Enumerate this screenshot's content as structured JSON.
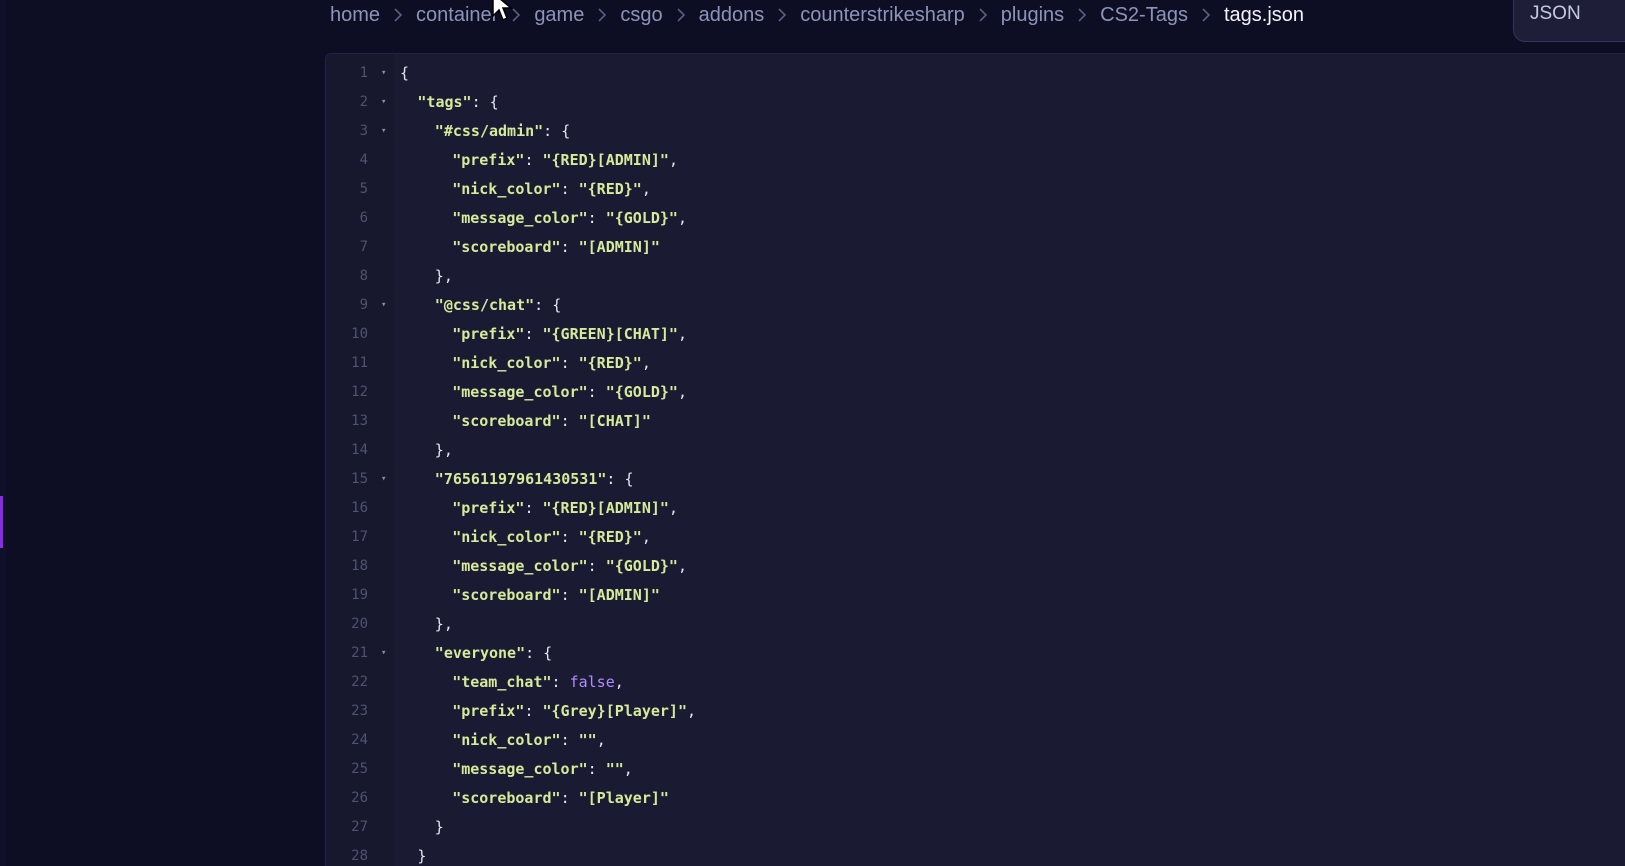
{
  "breadcrumb": {
    "items": [
      "home",
      "container",
      "game",
      "csgo",
      "addons",
      "counterstrikesharp",
      "plugins",
      "CS2-Tags",
      "tags.json"
    ]
  },
  "language_badge": "JSON",
  "editor": {
    "lines": [
      {
        "n": "1",
        "fold": true,
        "indent": 0,
        "parts": [
          [
            "p",
            "{"
          ]
        ]
      },
      {
        "n": "2",
        "fold": true,
        "indent": 1,
        "parts": [
          [
            "k",
            "\"tags\""
          ],
          [
            "p",
            ": {"
          ]
        ]
      },
      {
        "n": "3",
        "fold": true,
        "indent": 2,
        "parts": [
          [
            "k",
            "\"#css/admin\""
          ],
          [
            "p",
            ": {"
          ]
        ]
      },
      {
        "n": "4",
        "fold": false,
        "indent": 3,
        "parts": [
          [
            "k",
            "\"prefix\""
          ],
          [
            "p",
            ": "
          ],
          [
            "s",
            "\"{RED}[ADMIN]\""
          ],
          [
            "p",
            ","
          ]
        ]
      },
      {
        "n": "5",
        "fold": false,
        "indent": 3,
        "parts": [
          [
            "k",
            "\"nick_color\""
          ],
          [
            "p",
            ": "
          ],
          [
            "s",
            "\"{RED}\""
          ],
          [
            "p",
            ","
          ]
        ]
      },
      {
        "n": "6",
        "fold": false,
        "indent": 3,
        "parts": [
          [
            "k",
            "\"message_color\""
          ],
          [
            "p",
            ": "
          ],
          [
            "s",
            "\"{GOLD}\""
          ],
          [
            "p",
            ","
          ]
        ]
      },
      {
        "n": "7",
        "fold": false,
        "indent": 3,
        "parts": [
          [
            "k",
            "\"scoreboard\""
          ],
          [
            "p",
            ": "
          ],
          [
            "s",
            "\"[ADMIN]\""
          ]
        ]
      },
      {
        "n": "8",
        "fold": false,
        "indent": 2,
        "parts": [
          [
            "p",
            "},"
          ]
        ]
      },
      {
        "n": "9",
        "fold": true,
        "indent": 2,
        "parts": [
          [
            "k",
            "\"@css/chat\""
          ],
          [
            "p",
            ": {"
          ]
        ]
      },
      {
        "n": "10",
        "fold": false,
        "indent": 3,
        "parts": [
          [
            "k",
            "\"prefix\""
          ],
          [
            "p",
            ": "
          ],
          [
            "s",
            "\"{GREEN}[CHAT]\""
          ],
          [
            "p",
            ","
          ]
        ]
      },
      {
        "n": "11",
        "fold": false,
        "indent": 3,
        "parts": [
          [
            "k",
            "\"nick_color\""
          ],
          [
            "p",
            ": "
          ],
          [
            "s",
            "\"{RED}\""
          ],
          [
            "p",
            ","
          ]
        ]
      },
      {
        "n": "12",
        "fold": false,
        "indent": 3,
        "parts": [
          [
            "k",
            "\"message_color\""
          ],
          [
            "p",
            ": "
          ],
          [
            "s",
            "\"{GOLD}\""
          ],
          [
            "p",
            ","
          ]
        ]
      },
      {
        "n": "13",
        "fold": false,
        "indent": 3,
        "parts": [
          [
            "k",
            "\"scoreboard\""
          ],
          [
            "p",
            ": "
          ],
          [
            "s",
            "\"[CHAT]\""
          ]
        ]
      },
      {
        "n": "14",
        "fold": false,
        "indent": 2,
        "parts": [
          [
            "p",
            "},"
          ]
        ]
      },
      {
        "n": "15",
        "fold": true,
        "indent": 2,
        "parts": [
          [
            "k",
            "\"76561197961430531\""
          ],
          [
            "p",
            ": {"
          ]
        ]
      },
      {
        "n": "16",
        "fold": false,
        "indent": 3,
        "parts": [
          [
            "k",
            "\"prefix\""
          ],
          [
            "p",
            ": "
          ],
          [
            "s",
            "\"{RED}[ADMIN]\""
          ],
          [
            "p",
            ","
          ]
        ]
      },
      {
        "n": "17",
        "fold": false,
        "indent": 3,
        "parts": [
          [
            "k",
            "\"nick_color\""
          ],
          [
            "p",
            ": "
          ],
          [
            "s",
            "\"{RED}\""
          ],
          [
            "p",
            ","
          ]
        ]
      },
      {
        "n": "18",
        "fold": false,
        "indent": 3,
        "parts": [
          [
            "k",
            "\"message_color\""
          ],
          [
            "p",
            ": "
          ],
          [
            "s",
            "\"{GOLD}\""
          ],
          [
            "p",
            ","
          ]
        ]
      },
      {
        "n": "19",
        "fold": false,
        "indent": 3,
        "parts": [
          [
            "k",
            "\"scoreboard\""
          ],
          [
            "p",
            ": "
          ],
          [
            "s",
            "\"[ADMIN]\""
          ]
        ]
      },
      {
        "n": "20",
        "fold": false,
        "indent": 2,
        "parts": [
          [
            "p",
            "},"
          ]
        ]
      },
      {
        "n": "21",
        "fold": true,
        "indent": 2,
        "parts": [
          [
            "k",
            "\"everyone\""
          ],
          [
            "p",
            ": {"
          ]
        ]
      },
      {
        "n": "22",
        "fold": false,
        "indent": 3,
        "parts": [
          [
            "k",
            "\"team_chat\""
          ],
          [
            "p",
            ": "
          ],
          [
            "b",
            "false"
          ],
          [
            "p",
            ","
          ]
        ]
      },
      {
        "n": "23",
        "fold": false,
        "indent": 3,
        "parts": [
          [
            "k",
            "\"prefix\""
          ],
          [
            "p",
            ": "
          ],
          [
            "s",
            "\"{Grey}[Player]\""
          ],
          [
            "p",
            ","
          ]
        ]
      },
      {
        "n": "24",
        "fold": false,
        "indent": 3,
        "parts": [
          [
            "k",
            "\"nick_color\""
          ],
          [
            "p",
            ": "
          ],
          [
            "s",
            "\"\""
          ],
          [
            "p",
            ","
          ]
        ]
      },
      {
        "n": "25",
        "fold": false,
        "indent": 3,
        "parts": [
          [
            "k",
            "\"message_color\""
          ],
          [
            "p",
            ": "
          ],
          [
            "s",
            "\"\""
          ],
          [
            "p",
            ","
          ]
        ]
      },
      {
        "n": "26",
        "fold": false,
        "indent": 3,
        "parts": [
          [
            "k",
            "\"scoreboard\""
          ],
          [
            "p",
            ": "
          ],
          [
            "s",
            "\"[Player]\""
          ]
        ]
      },
      {
        "n": "27",
        "fold": false,
        "indent": 2,
        "parts": [
          [
            "p",
            "}"
          ]
        ]
      },
      {
        "n": "28",
        "fold": false,
        "indent": 1,
        "parts": [
          [
            "p",
            "}"
          ]
        ]
      }
    ]
  },
  "icons": {
    "separator": "chevron-right-icon",
    "fold": "fold-arrow-icon",
    "pointer": "mouse-pointer-icon"
  },
  "colors": {
    "background": "#0d0d24",
    "editor_background": "#1a1a33",
    "string": "#d6ea9a",
    "boolean": "#b08cff",
    "accent": "#8a2be2"
  }
}
